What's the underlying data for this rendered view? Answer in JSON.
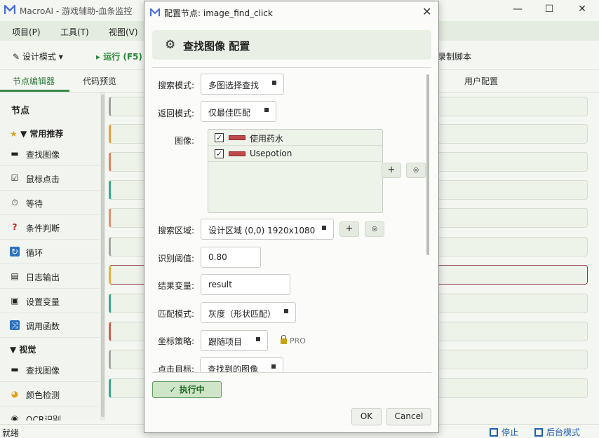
{
  "app": {
    "title": "MacroAI - 游戏辅助-血条监控"
  },
  "window_controls": {
    "minimize": "—",
    "maximize": "☐",
    "close": "✕"
  },
  "menu": [
    "项目(P)",
    "工具(T)",
    "视图(V)"
  ],
  "toolbar": {
    "design_mode": "设计模式 ▾",
    "run": "▸ 运行 (F5)",
    "record": "录制脚本"
  },
  "tabs": {
    "node_editor": "节点编辑器",
    "code_preview": "代码预览",
    "user_config": "用户配置"
  },
  "sidebar": {
    "title": "节点",
    "section_common": "▼ 常用推荐",
    "common_items": [
      {
        "label": "查找图像",
        "icon": "▬"
      },
      {
        "label": "鼠标点击",
        "icon": "☑"
      },
      {
        "label": "等待",
        "icon": "⏱"
      },
      {
        "label": "条件判断",
        "icon": "?"
      },
      {
        "label": "循环",
        "icon": "↻"
      },
      {
        "label": "日志输出",
        "icon": "▤"
      },
      {
        "label": "设置变量",
        "icon": "▣"
      },
      {
        "label": "调用函数",
        "icon": "⤨"
      }
    ],
    "section_vision": "▼ 视觉",
    "vision_items": [
      {
        "label": "查找图像",
        "icon": "▬"
      },
      {
        "label": "颜色检测",
        "icon": "◕"
      },
      {
        "label": "OCR识别",
        "icon": "◉"
      }
    ]
  },
  "node_bar_colors": [
    "#9aa29a",
    "#e8a040",
    "#e08060",
    "#3aa98a",
    "#e09070",
    "#a0a8a0",
    "#e8b040",
    "#3aa98a",
    "#d06050",
    "#a0a8a0",
    "#3aa98a"
  ],
  "dialog": {
    "title": "配置节点: image_find_click",
    "close": "✕",
    "header": "查找图像 配置",
    "fields": {
      "search_mode_label": "搜索模式:",
      "search_mode_value": "多图选择查找",
      "return_mode_label": "返回模式:",
      "return_mode_value": "仅最佳匹配",
      "images_label": "图像:",
      "images": [
        {
          "name": "使用药水",
          "checked": "✓"
        },
        {
          "name": "Usepotion",
          "checked": "✓"
        }
      ],
      "add_btn": "+",
      "refresh_btn": "◎",
      "search_region_label": "搜索区域:",
      "search_region_value": "设计区域 (0,0) 1920x1080",
      "threshold_label": "识别阈值:",
      "threshold_value": "0.80",
      "result_var_label": "结果变量:",
      "result_var_value": "result",
      "match_mode_label": "匹配模式:",
      "match_mode_value": "灰度（形状匹配）",
      "coord_strategy_label": "坐标策略:",
      "coord_strategy_value": "跟随项目",
      "pro_label": "PRO",
      "click_target_label": "点击目标:",
      "click_target_value": "查找到的图像"
    },
    "exec_button": "✓ 执行中",
    "ok": "OK",
    "cancel": "Cancel"
  },
  "status": {
    "text": "就绪",
    "stop": "停止",
    "background": "后台模式"
  }
}
